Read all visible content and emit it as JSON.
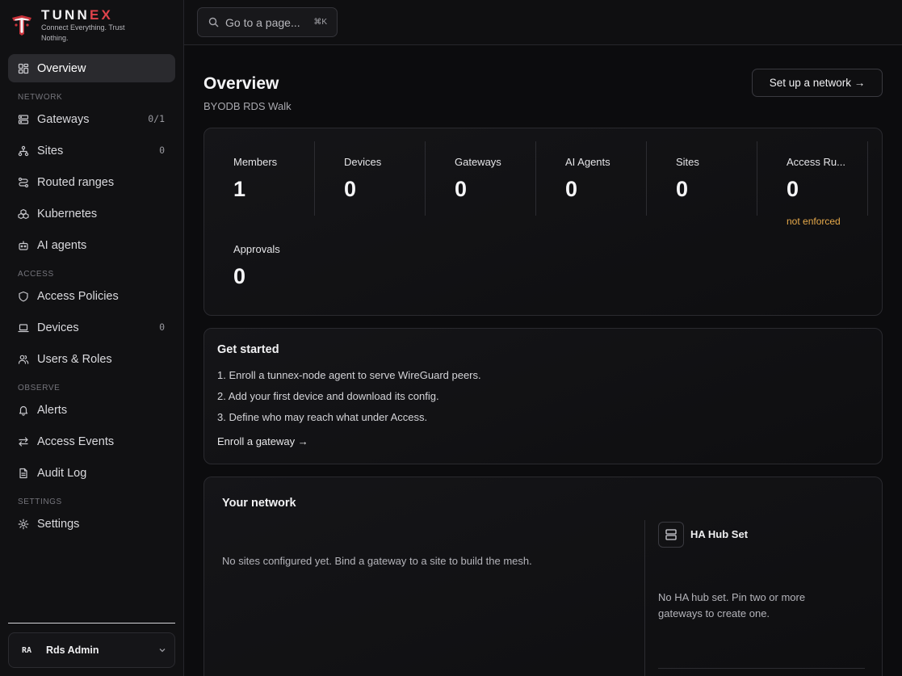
{
  "brand": {
    "name_main": "TUNN",
    "name_accent": "EX",
    "tagline": "Connect Everything. Trust Nothing.",
    "accent_color": "#e0434b"
  },
  "search": {
    "placeholder": "Go to a page...",
    "shortcut": "⌘K",
    "icon": "search-icon"
  },
  "sidebar": {
    "top_item": {
      "label": "Overview",
      "icon": "grid-icon",
      "active": true
    },
    "sections": [
      {
        "title": "NETWORK",
        "items": [
          {
            "label": "Gateways",
            "icon": "server-icon",
            "count": "0/1"
          },
          {
            "label": "Sites",
            "icon": "sitemap-icon",
            "count": "0"
          },
          {
            "label": "Routed ranges",
            "icon": "route-icon",
            "count": ""
          },
          {
            "label": "Kubernetes",
            "icon": "cubes-icon",
            "count": ""
          },
          {
            "label": "AI agents",
            "icon": "bot-icon",
            "count": ""
          }
        ]
      },
      {
        "title": "ACCESS",
        "items": [
          {
            "label": "Access Policies",
            "icon": "shield-icon",
            "count": ""
          },
          {
            "label": "Devices",
            "icon": "laptop-icon",
            "count": "0"
          },
          {
            "label": "Users & Roles",
            "icon": "users-icon",
            "count": ""
          }
        ]
      },
      {
        "title": "OBSERVE",
        "items": [
          {
            "label": "Alerts",
            "icon": "bell-icon",
            "count": ""
          },
          {
            "label": "Access Events",
            "icon": "arrows-icon",
            "count": ""
          },
          {
            "label": "Audit Log",
            "icon": "document-icon",
            "count": ""
          }
        ]
      },
      {
        "title": "SETTINGS",
        "items": [
          {
            "label": "Settings",
            "icon": "gear-icon",
            "count": ""
          }
        ]
      }
    ],
    "user": {
      "initials": "RA",
      "name": "Rds Admin"
    }
  },
  "header": {
    "title": "Overview",
    "subtitle": "BYODB RDS Walk",
    "setup_button": "Set up a network →"
  },
  "stats": [
    {
      "label": "Members",
      "value": "1",
      "note": ""
    },
    {
      "label": "Devices",
      "value": "0",
      "note": ""
    },
    {
      "label": "Gateways",
      "value": "0",
      "note": ""
    },
    {
      "label": "AI Agents",
      "value": "0",
      "note": ""
    },
    {
      "label": "Sites",
      "value": "0",
      "note": ""
    },
    {
      "label": "Access Ru...",
      "value": "0",
      "note": "not enforced"
    },
    {
      "label": "Approvals",
      "value": "0",
      "note": ""
    }
  ],
  "get_started": {
    "title": "Get started",
    "steps": [
      "1. Enroll a tunnex-node agent to serve WireGuard peers.",
      "2. Add your first device and download its config.",
      "3. Define who may reach what under Access."
    ],
    "link": "Enroll a gateway →"
  },
  "network": {
    "title": "Your network",
    "empty_message": "No sites configured yet. Bind a gateway to a site to build the mesh.",
    "ha": {
      "title": "HA Hub Set",
      "icon": "server-icon",
      "empty_message": "No HA hub set. Pin two or more gateways to create one."
    }
  }
}
